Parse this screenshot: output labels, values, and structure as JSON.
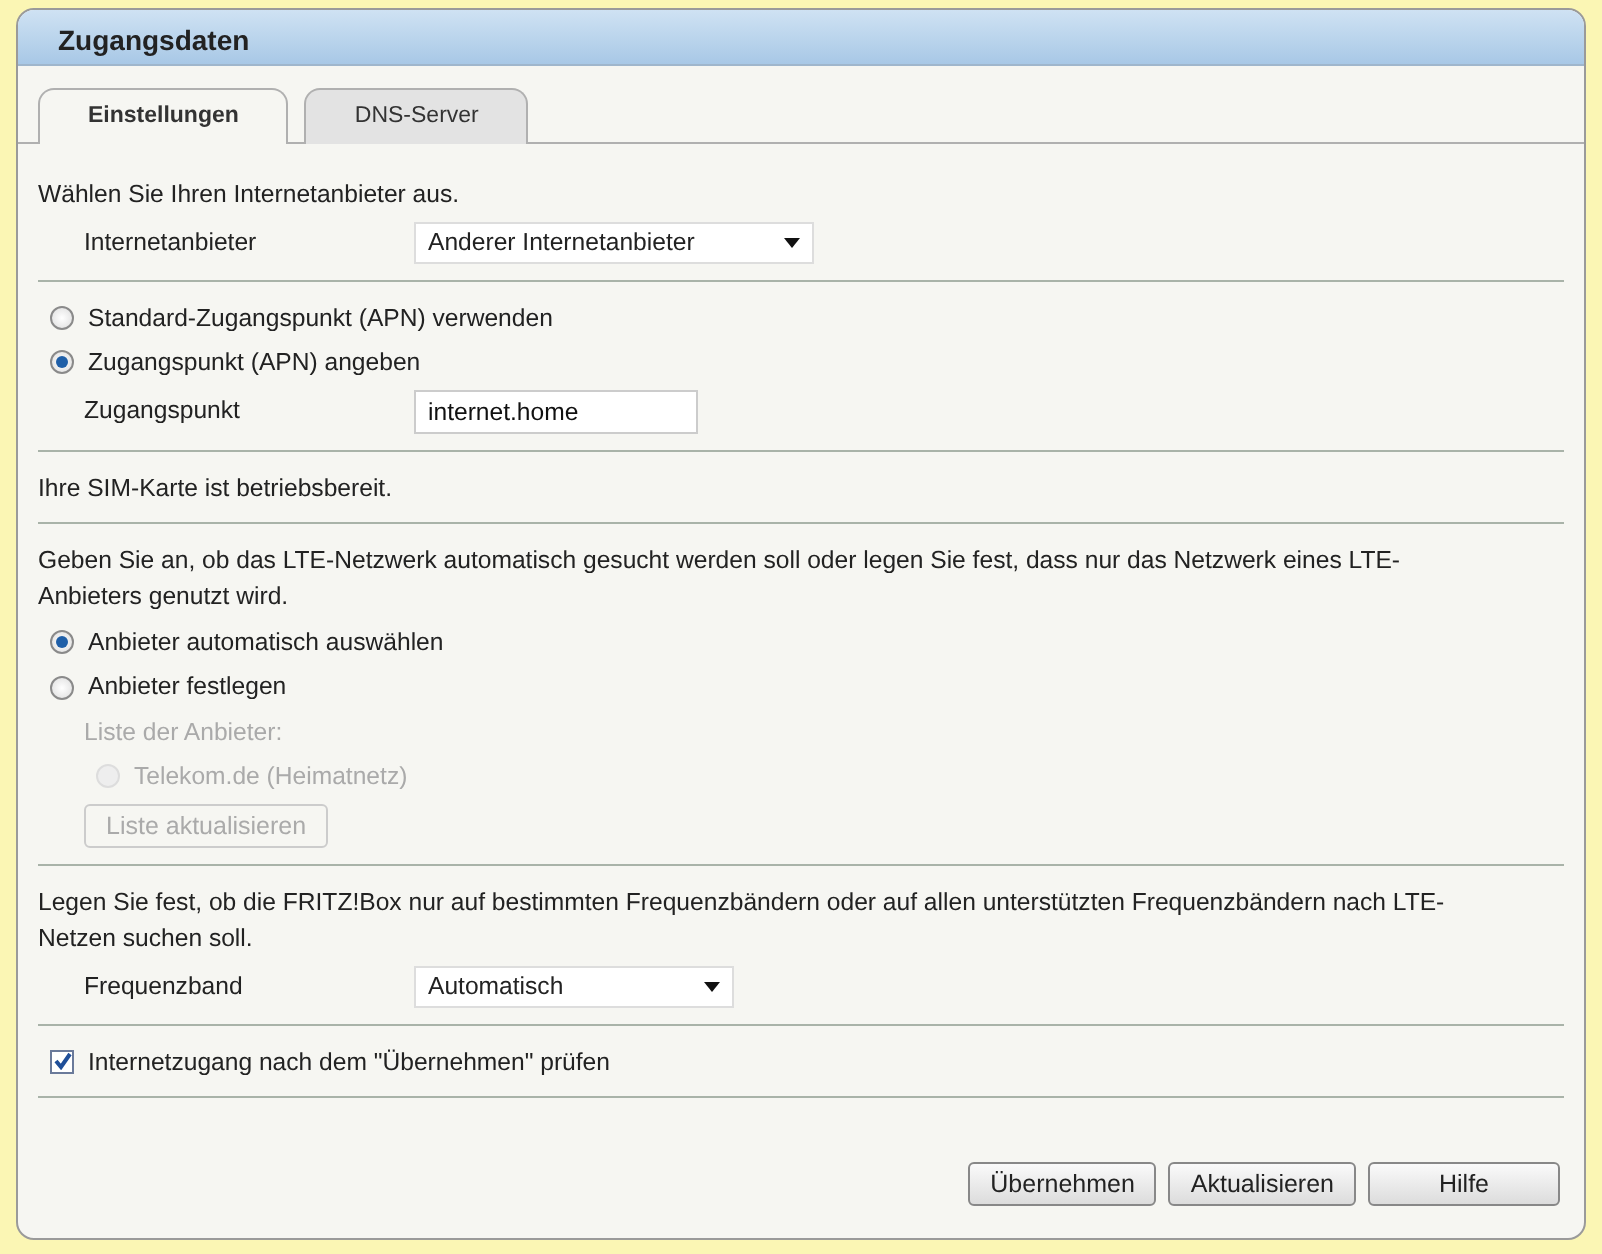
{
  "panel": {
    "title": "Zugangsdaten"
  },
  "tabs": [
    {
      "label": "Einstellungen",
      "selected": true
    },
    {
      "label": "DNS-Server",
      "selected": false
    }
  ],
  "sections": [
    {
      "items": [
        {
          "kind": "text",
          "text": "Wählen Sie Ihren Internetanbieter aus."
        },
        {
          "kind": "select",
          "label": "Internetanbieter",
          "value": "Anderer Internetanbieter",
          "wide": true
        }
      ]
    },
    {
      "items": [
        {
          "kind": "radio",
          "label": "Standard-Zugangspunkt (APN) verwenden",
          "selected": false,
          "disabled": false
        },
        {
          "kind": "radio",
          "label": "Zugangspunkt (APN) angeben",
          "selected": true,
          "disabled": false
        },
        {
          "kind": "input",
          "label": "Zugangspunkt",
          "value": "internet.home"
        }
      ]
    },
    {
      "items": [
        {
          "kind": "text",
          "text": "Ihre SIM-Karte ist betriebsbereit."
        }
      ]
    },
    {
      "items": [
        {
          "kind": "text",
          "text": "Geben Sie an, ob das LTE-Netzwerk automatisch gesucht werden soll oder legen Sie fest, dass nur das Netzwerk eines LTE-Anbieters genutzt wird."
        },
        {
          "kind": "radio",
          "label": "Anbieter automatisch auswählen",
          "selected": true,
          "disabled": false
        },
        {
          "kind": "radio",
          "label": "Anbieter festlegen",
          "selected": false,
          "disabled": false
        },
        {
          "kind": "sublabel",
          "text": "Liste der Anbieter:",
          "disabled": true
        },
        {
          "kind": "subradio",
          "label": "Telekom.de (Heimatnetz)",
          "selected": false,
          "disabled": true
        },
        {
          "kind": "button",
          "label": "Liste aktualisieren",
          "disabled": true
        }
      ]
    },
    {
      "items": [
        {
          "kind": "text",
          "text": "Legen Sie fest, ob die FRITZ!Box nur auf bestimmten Frequenzbändern oder auf allen unterstützten Frequenzbändern nach LTE-Netzen suchen soll."
        },
        {
          "kind": "select",
          "label": "Frequenzband",
          "value": "Automatisch",
          "wide": false
        }
      ]
    },
    {
      "items": [
        {
          "kind": "checkbox",
          "label": "Internetzugang nach dem \"Übernehmen\" prüfen",
          "checked": true
        }
      ]
    }
  ],
  "buttons": [
    {
      "label": "Übernehmen"
    },
    {
      "label": "Aktualisieren"
    },
    {
      "label": "Hilfe"
    }
  ]
}
